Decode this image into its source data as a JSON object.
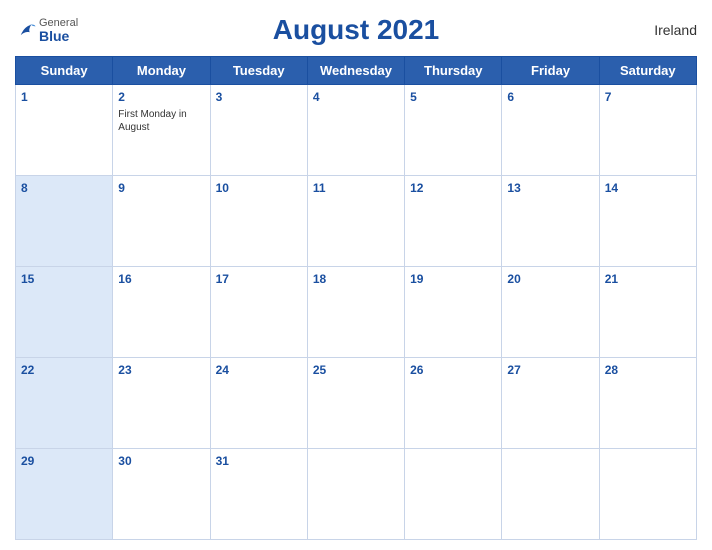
{
  "header": {
    "title": "August 2021",
    "country": "Ireland",
    "logo": {
      "general": "General",
      "blue": "Blue"
    }
  },
  "weekdays": [
    "Sunday",
    "Monday",
    "Tuesday",
    "Wednesday",
    "Thursday",
    "Friday",
    "Saturday"
  ],
  "weeks": [
    [
      {
        "day": "1",
        "blue": false,
        "holiday": ""
      },
      {
        "day": "2",
        "blue": false,
        "holiday": "First Monday in August"
      },
      {
        "day": "3",
        "blue": false,
        "holiday": ""
      },
      {
        "day": "4",
        "blue": false,
        "holiday": ""
      },
      {
        "day": "5",
        "blue": false,
        "holiday": ""
      },
      {
        "day": "6",
        "blue": false,
        "holiday": ""
      },
      {
        "day": "7",
        "blue": false,
        "holiday": ""
      }
    ],
    [
      {
        "day": "8",
        "blue": true,
        "holiday": ""
      },
      {
        "day": "9",
        "blue": false,
        "holiday": ""
      },
      {
        "day": "10",
        "blue": false,
        "holiday": ""
      },
      {
        "day": "11",
        "blue": false,
        "holiday": ""
      },
      {
        "day": "12",
        "blue": false,
        "holiday": ""
      },
      {
        "day": "13",
        "blue": false,
        "holiday": ""
      },
      {
        "day": "14",
        "blue": false,
        "holiday": ""
      }
    ],
    [
      {
        "day": "15",
        "blue": true,
        "holiday": ""
      },
      {
        "day": "16",
        "blue": false,
        "holiday": ""
      },
      {
        "day": "17",
        "blue": false,
        "holiday": ""
      },
      {
        "day": "18",
        "blue": false,
        "holiday": ""
      },
      {
        "day": "19",
        "blue": false,
        "holiday": ""
      },
      {
        "day": "20",
        "blue": false,
        "holiday": ""
      },
      {
        "day": "21",
        "blue": false,
        "holiday": ""
      }
    ],
    [
      {
        "day": "22",
        "blue": true,
        "holiday": ""
      },
      {
        "day": "23",
        "blue": false,
        "holiday": ""
      },
      {
        "day": "24",
        "blue": false,
        "holiday": ""
      },
      {
        "day": "25",
        "blue": false,
        "holiday": ""
      },
      {
        "day": "26",
        "blue": false,
        "holiday": ""
      },
      {
        "day": "27",
        "blue": false,
        "holiday": ""
      },
      {
        "day": "28",
        "blue": false,
        "holiday": ""
      }
    ],
    [
      {
        "day": "29",
        "blue": true,
        "holiday": ""
      },
      {
        "day": "30",
        "blue": false,
        "holiday": ""
      },
      {
        "day": "31",
        "blue": false,
        "holiday": ""
      },
      {
        "day": "",
        "blue": false,
        "holiday": ""
      },
      {
        "day": "",
        "blue": false,
        "holiday": ""
      },
      {
        "day": "",
        "blue": false,
        "holiday": ""
      },
      {
        "day": "",
        "blue": false,
        "holiday": ""
      }
    ]
  ]
}
